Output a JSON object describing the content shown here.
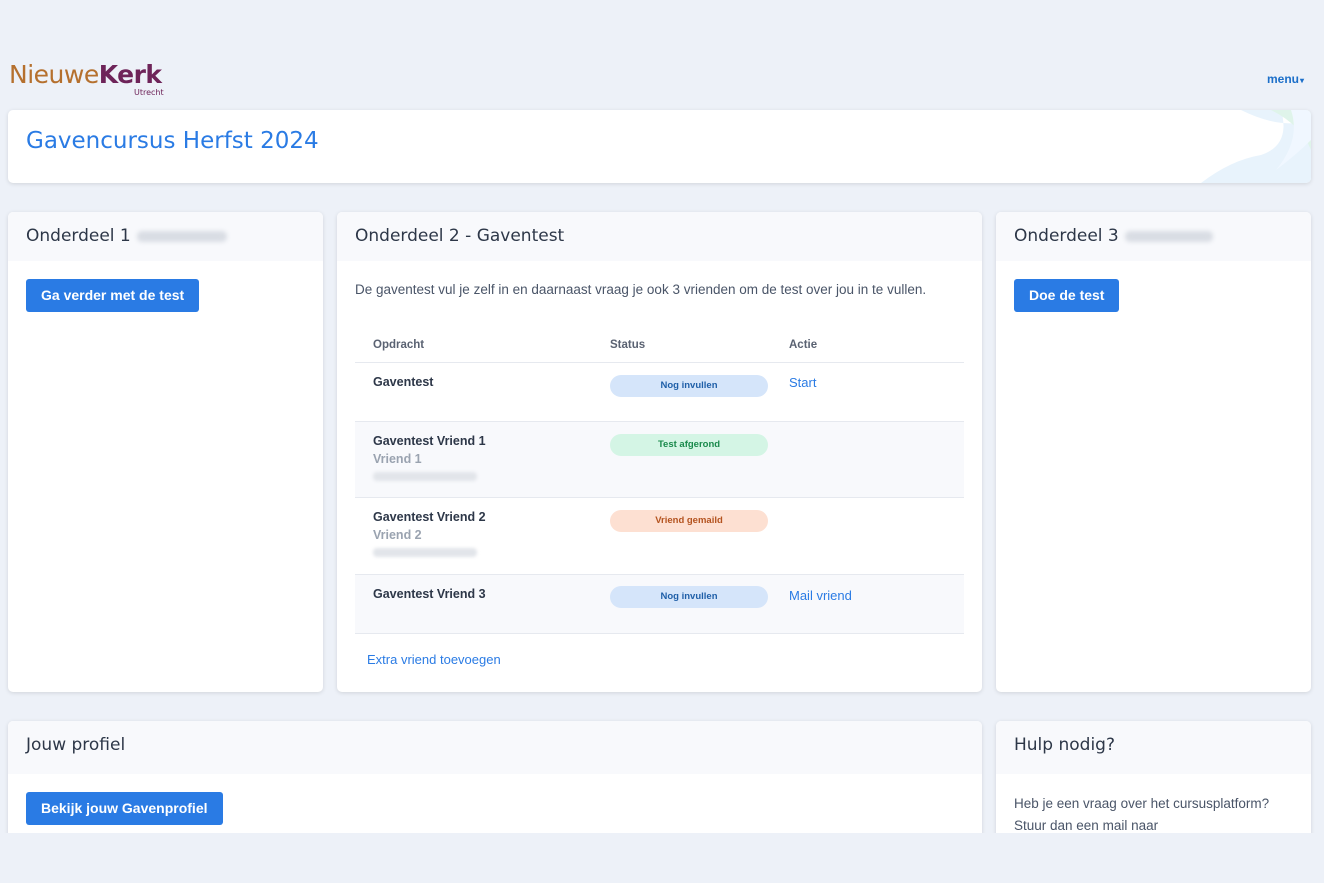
{
  "logo": {
    "part1": "Nieuwe",
    "part2": "Kerk",
    "sub": "Utrecht"
  },
  "menu": {
    "label": "menu"
  },
  "page": {
    "title": "Gavencursus Herfst 2024"
  },
  "section1": {
    "title": "Onderdeel 1",
    "button": "Ga verder met de test"
  },
  "section2": {
    "title": "Onderdeel 2 - Gaventest",
    "intro": "De gaventest vul je zelf in en daarnaast vraag je ook 3 vrienden om de test over jou in te vullen.",
    "columns": [
      "Opdracht",
      "Status",
      "Actie"
    ],
    "rows": [
      {
        "task": "Gaventest",
        "friend": "",
        "status": "Nog invullen",
        "action": "Start"
      },
      {
        "task": "Gaventest Vriend 1",
        "friend": "Vriend 1",
        "status": "Test afgerond",
        "action": ""
      },
      {
        "task": "Gaventest Vriend 2",
        "friend": "Vriend 2",
        "status": "Vriend gemaild",
        "action": ""
      },
      {
        "task": "Gaventest Vriend 3",
        "friend": "",
        "status": "Nog invullen",
        "action": "Mail vriend"
      }
    ],
    "extra_link": "Extra vriend toevoegen"
  },
  "section3": {
    "title": "Onderdeel 3",
    "button": "Doe de test"
  },
  "profile": {
    "title": "Jouw profiel",
    "button": "Bekijk jouw Gavenprofiel"
  },
  "help": {
    "title": "Hulp nodig?",
    "text": "Heb je een vraag over het cursusplatform? Stuur dan een mail naar"
  },
  "colors": {
    "accent": "#2a7be4",
    "background": "#edf1f8"
  }
}
